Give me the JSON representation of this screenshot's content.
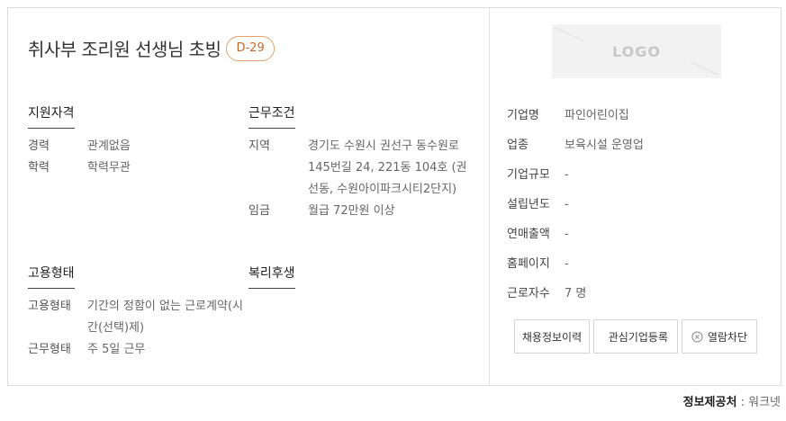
{
  "job": {
    "title": "취사부 조리원 선생님 초빙",
    "dday": "D-29"
  },
  "qualification": {
    "heading": "지원자격",
    "items": [
      {
        "label": "경력",
        "value": "관계없음"
      },
      {
        "label": "학력",
        "value": "학력무관"
      }
    ]
  },
  "conditions": {
    "heading": "근무조건",
    "items": [
      {
        "label": "지역",
        "value_lines": [
          "경기도 수원시 권선구 동수원로",
          "145번길 24, 221동 104호 (권",
          "선동, 수원아이파크시티2단지)"
        ]
      },
      {
        "label": "임금",
        "value": "월급 72만원 이상"
      }
    ]
  },
  "employment": {
    "heading": "고용형태",
    "items": [
      {
        "label": "고용형태",
        "value_lines": [
          "기간의 정함이 없는 근로계약(시",
          "간(선택)제)"
        ]
      },
      {
        "label": "근무형태",
        "value": "주 5일 근무"
      }
    ]
  },
  "welfare": {
    "heading": "복리후생"
  },
  "company": {
    "logo_text": "LOGO",
    "fields": [
      {
        "label": "기업명",
        "value": "파인어린이집"
      },
      {
        "label": "업종",
        "value": "보육시설 운영업"
      },
      {
        "label": "기업규모",
        "value": "-"
      },
      {
        "label": "설립년도",
        "value": "-"
      },
      {
        "label": "연매출액",
        "value": "-"
      },
      {
        "label": "홈페이지",
        "value": "-"
      },
      {
        "label": "근로자수",
        "value": "7 명"
      }
    ]
  },
  "actions": {
    "history": "채용정보이력",
    "favorite": "관심기업등록",
    "block": "열람차단"
  },
  "footer": {
    "source_label": "정보제공처",
    "source_sep": " : ",
    "source_value": "워크넷"
  },
  "icons": {
    "favorite": "heart-icon",
    "block": "close-circle-icon"
  },
  "colors": {
    "dday_border": "#e6a06a",
    "dday_text": "#c86a2b"
  }
}
